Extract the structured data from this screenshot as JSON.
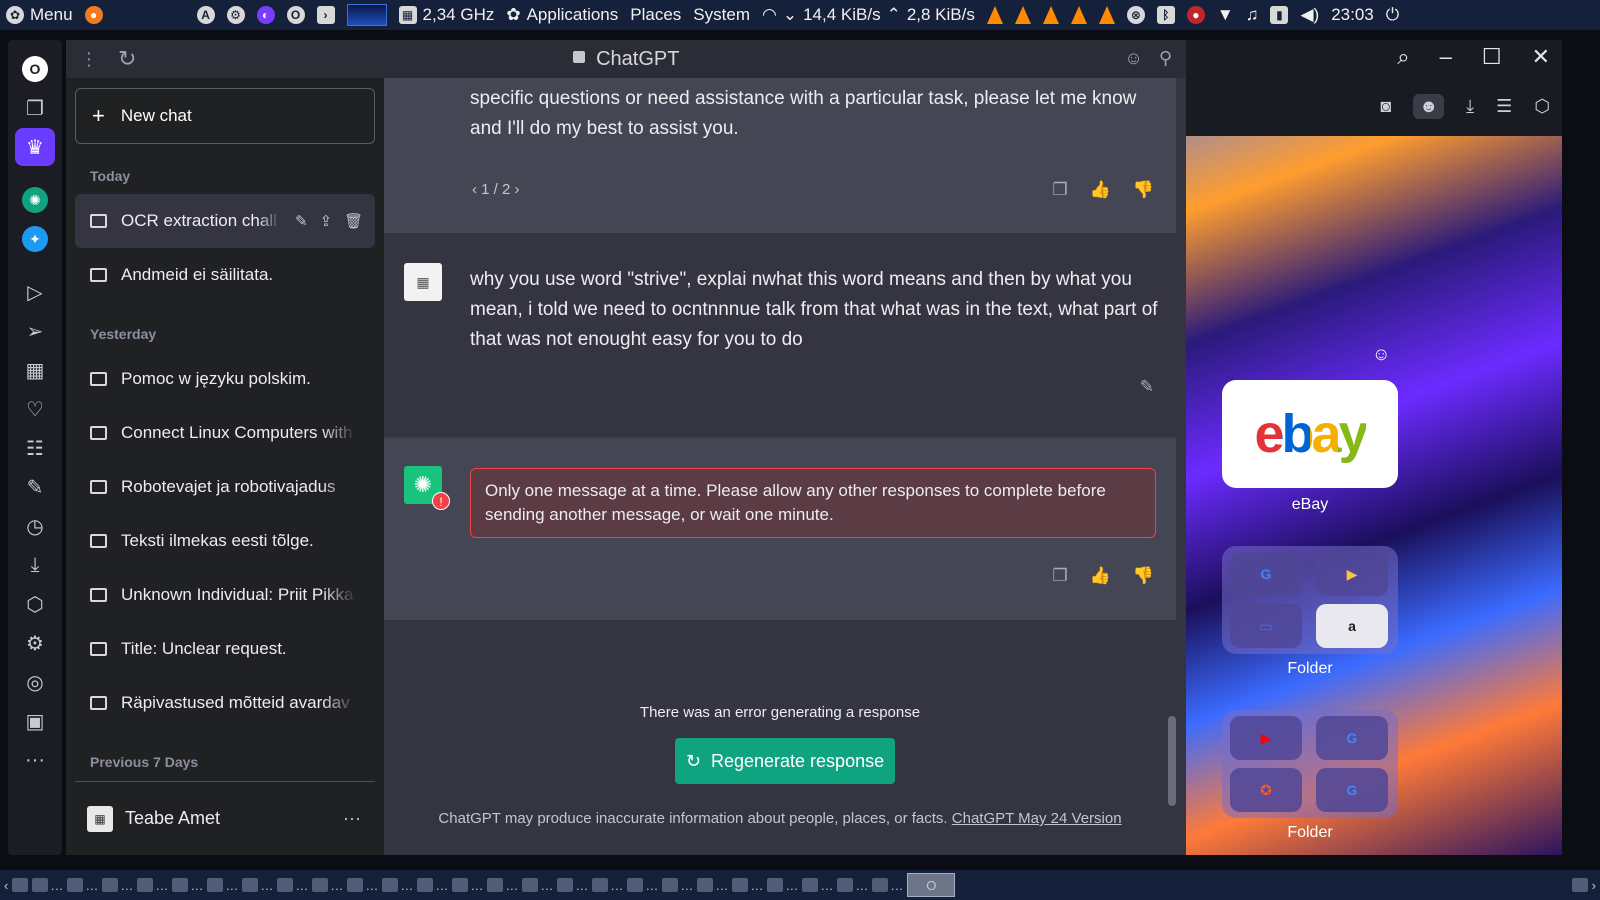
{
  "top_panel": {
    "menu_label": "Menu",
    "cpu_freq": "2,34 GHz",
    "applications_label": "Applications",
    "places_label": "Places",
    "system_label": "System",
    "down_speed": "14,4 KiB/s",
    "up_speed": "2,8 KiB/s",
    "clock": "23:03"
  },
  "browser": {
    "title": "ChatGPT"
  },
  "sidebar": {
    "new_chat_label": "New chat",
    "sections": [
      {
        "label": "Today",
        "items": [
          {
            "label": "OCR extraction chall"
          },
          {
            "label": "Andmeid ei säilitata."
          }
        ]
      },
      {
        "label": "Yesterday",
        "items": [
          {
            "label": "Pomoc w języku polskim."
          },
          {
            "label": "Connect Linux Computers with"
          },
          {
            "label": "Robotevajet ja robotivajadus"
          },
          {
            "label": "Teksti ilmekas eesti tõlge."
          },
          {
            "label": "Unknown Individual: Priit Pikka"
          },
          {
            "label": "Title: Unclear request."
          },
          {
            "label": "Räpivastused mõtteid avardav"
          }
        ]
      },
      {
        "label": "Previous 7 Days",
        "items": []
      }
    ],
    "user_name": "Teabe Amet",
    "more_label": "···"
  },
  "conversation": {
    "assistant_msg_1": "specific questions or need assistance with a particular task, please let me know and I'll do my best to assist you.",
    "pager": "1 / 2",
    "user_msg": "why you use word \"strive\", explai nwhat this word means and then by what you mean, i told we need to ocntnnnue talk from that what was in the text, what part of that was not  enought easy for you to do",
    "error_msg": "Only one message at a time. Please allow any other responses to complete before sending another message, or wait one minute.",
    "error_generating": "There was an error generating a response",
    "regenerate_label": "Regenerate response",
    "disclaimer": "ChatGPT may produce inaccurate information about people, places, or facts.",
    "version_link": "ChatGPT May 24 Version"
  },
  "speed_dial": {
    "ebay_label": "eBay",
    "ebay_logo": "ebay",
    "folder_label": "Folder",
    "folder2_label": "Folder"
  },
  "colors": {
    "accent_green": "#10a37f",
    "error_red": "#ef4146",
    "sidebar_bg": "#202123",
    "chat_bg": "#343541",
    "assistant_bg": "#444654",
    "opera_accent": "#6a3cff"
  }
}
